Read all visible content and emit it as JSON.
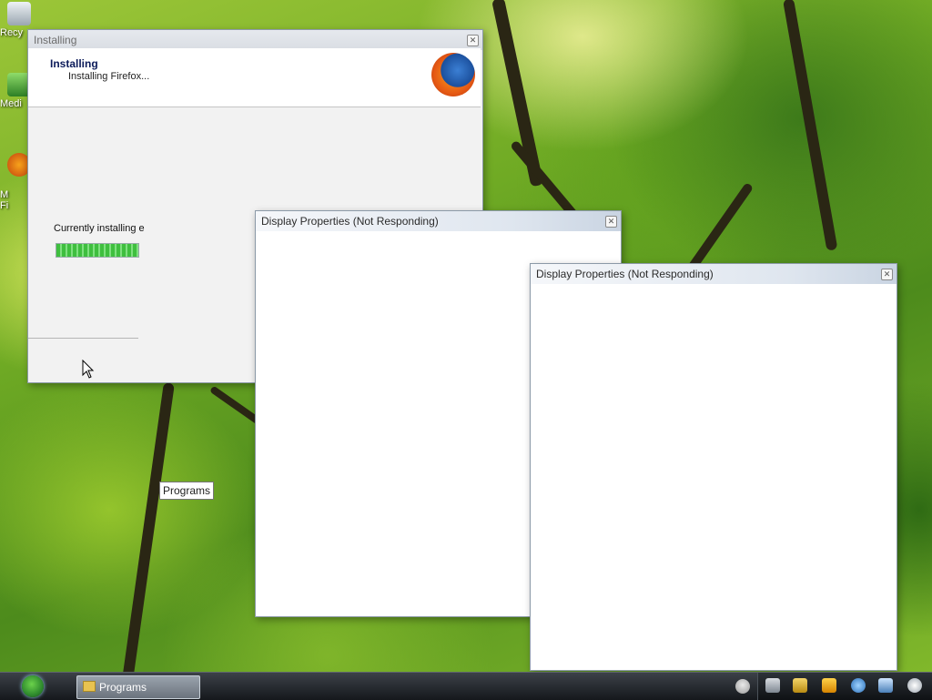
{
  "desktop": {
    "icons": [
      {
        "label": "Recy"
      },
      {
        "label": "Medi"
      },
      {
        "label": "M\nFi"
      }
    ],
    "tooltip": "Programs"
  },
  "installer": {
    "window_title": "Installing",
    "header_title": "Installing",
    "header_subtitle": "Installing Firefox...",
    "status_text": "Currently installing e",
    "progress_fraction": 1.0
  },
  "display_windows": [
    {
      "title": "Display Properties (Not Responding)"
    },
    {
      "title": "Display Properties (Not Responding)"
    }
  ],
  "taskbar": {
    "task_button_label": "Programs",
    "tray_icons": [
      "search-icon",
      "bell-icon",
      "lightning-icon",
      "globe-icon",
      "network-icon",
      "clock-icon"
    ]
  },
  "colors": {
    "installer_title": "#0c1b5a",
    "progress_green": "#3fbf3f"
  }
}
